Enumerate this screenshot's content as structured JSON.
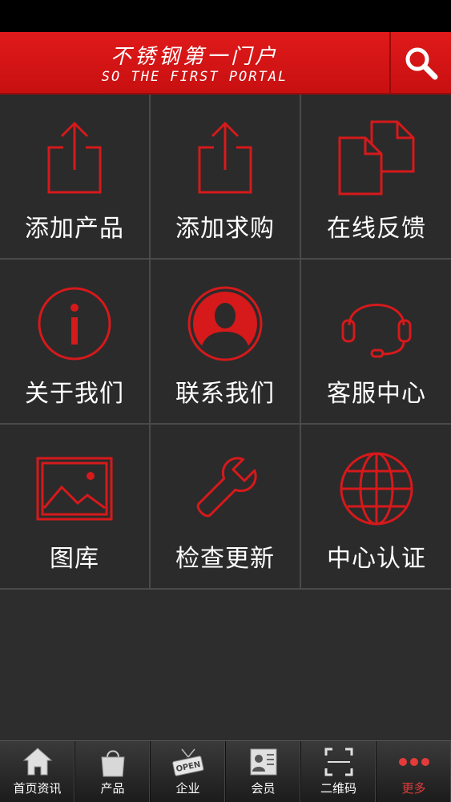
{
  "header": {
    "title_cn": "不锈钢第一门户",
    "title_en": "SO THE FIRST PORTAL",
    "search_icon": "search-icon",
    "bg_color": "#d61414"
  },
  "accent_color": "#d6191b",
  "grid": {
    "items": [
      {
        "label": "添加产品",
        "icon": "share-export-icon"
      },
      {
        "label": "添加求购",
        "icon": "share-export-icon"
      },
      {
        "label": "在线反馈",
        "icon": "copy-documents-icon"
      },
      {
        "label": "关于我们",
        "icon": "info-icon"
      },
      {
        "label": "联系我们",
        "icon": "contact-person-icon"
      },
      {
        "label": "客服中心",
        "icon": "headset-icon"
      },
      {
        "label": "图库",
        "icon": "picture-icon"
      },
      {
        "label": "检查更新",
        "icon": "wrench-icon"
      },
      {
        "label": "中心认证",
        "icon": "globe-icon"
      }
    ]
  },
  "tabbar": {
    "tabs": [
      {
        "label": "首页资讯",
        "icon": "home-icon",
        "active": false
      },
      {
        "label": "产品",
        "icon": "shopping-bag-icon",
        "active": false
      },
      {
        "label": "企业",
        "icon": "open-sign-icon",
        "active": false
      },
      {
        "label": "会员",
        "icon": "member-card-icon",
        "active": false
      },
      {
        "label": "二维码",
        "icon": "qr-scan-icon",
        "active": false
      },
      {
        "label": "更多",
        "icon": "more-dots-icon",
        "active": true
      }
    ],
    "open_sign_text": "OPEN"
  }
}
